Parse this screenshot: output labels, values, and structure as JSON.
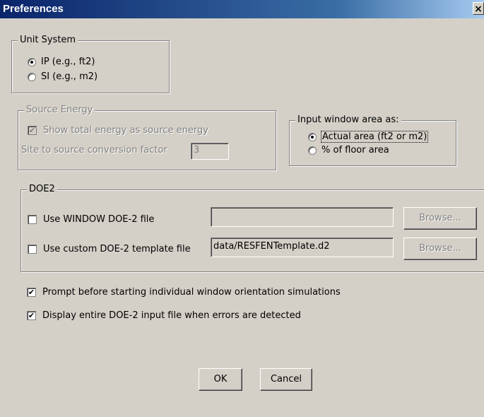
{
  "window": {
    "title": "Preferences",
    "close_glyph": "×"
  },
  "unit_system": {
    "legend": "Unit System",
    "options": [
      {
        "label": "IP (e.g., ft2)",
        "selected": true
      },
      {
        "label": "SI (e.g., m2)",
        "selected": false
      }
    ]
  },
  "source_energy": {
    "legend": "Source Energy",
    "show_total_label": "Show total energy as source energy",
    "show_total_checked": true,
    "factor_label": "Site to source conversion factor",
    "factor_value": "3"
  },
  "window_area": {
    "legend": "Input window area as:",
    "options": [
      {
        "label": "Actual area (ft2 or m2)",
        "selected": true
      },
      {
        "label": "% of floor area",
        "selected": false
      }
    ]
  },
  "doe2": {
    "legend": "DOE2",
    "window_file": {
      "label": "Use WINDOW DOE-2 file",
      "checked": false,
      "value": "",
      "browse_label": "Browse..."
    },
    "template_file": {
      "label": "Use custom DOE-2 template file",
      "checked": false,
      "value": "data/RESFENTemplate.d2",
      "browse_label": "Browse..."
    }
  },
  "options": {
    "prompt_label": "Prompt before starting individual window orientation simulations",
    "prompt_checked": true,
    "display_label": "Display entire DOE-2 input file when errors are detected",
    "display_checked": true
  },
  "buttons": {
    "ok": "OK",
    "cancel": "Cancel"
  },
  "check_glyph": "✔"
}
